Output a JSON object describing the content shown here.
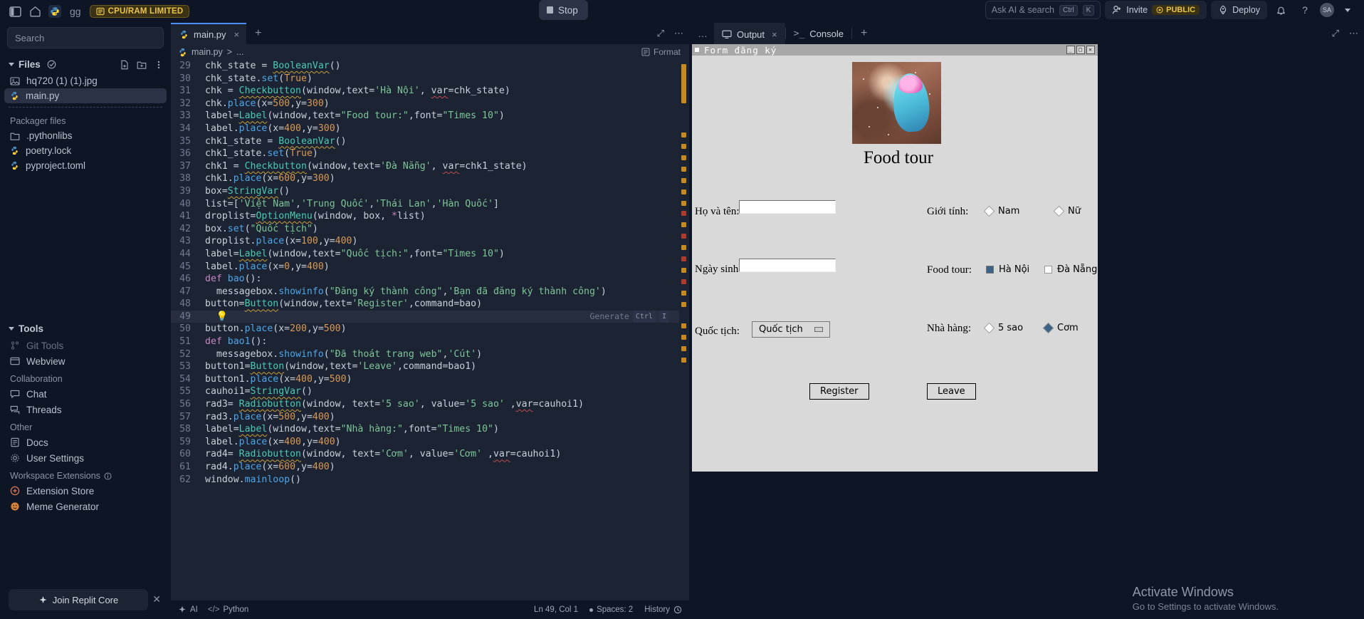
{
  "topbar": {
    "gg_label": "gg",
    "cpu_badge": "CPU/RAM LIMITED",
    "stop_label": "Stop",
    "ask_ai_placeholder": "Ask AI & search",
    "kbd_ctrl": "Ctrl",
    "kbd_k": "K",
    "invite_label": "Invite",
    "public_label": "PUBLIC",
    "deploy_label": "Deploy",
    "avatar_initials": "SA"
  },
  "sidebar": {
    "search_placeholder": "Search",
    "files_title": "Files",
    "files": [
      {
        "name": "hq720 (1) (1).jpg",
        "icon": "image-icon",
        "selected": false
      },
      {
        "name": "main.py",
        "icon": "python-icon",
        "selected": true
      }
    ],
    "packager_title": "Packager files",
    "packager_files": [
      {
        "name": ".pythonlibs",
        "icon": "folder-icon"
      },
      {
        "name": "poetry.lock",
        "icon": "python-icon"
      },
      {
        "name": "pyproject.toml",
        "icon": "python-icon"
      }
    ],
    "tools_title": "Tools",
    "tools": [
      {
        "name": "Git Tools",
        "icon": "git-icon"
      },
      {
        "name": "Webview",
        "icon": "webview-icon"
      }
    ],
    "collab_title": "Collaboration",
    "collab": [
      {
        "name": "Chat",
        "icon": "chat-icon"
      },
      {
        "name": "Threads",
        "icon": "threads-icon"
      }
    ],
    "other_title": "Other",
    "other": [
      {
        "name": "Docs",
        "icon": "docs-icon"
      },
      {
        "name": "User Settings",
        "icon": "gear-icon"
      }
    ],
    "ext_title": "Workspace Extensions",
    "extensions": [
      {
        "name": "Extension Store",
        "icon": "store-icon"
      },
      {
        "name": "Meme Generator",
        "icon": "meme-icon"
      }
    ],
    "core_button": "Join Replit Core"
  },
  "editor": {
    "tab_name": "main.py",
    "tab_plus": "+",
    "breadcrumb_file": "main.py",
    "breadcrumb_sep": ">",
    "breadcrumb_rest": "...",
    "format_label": "Format",
    "ghost_label": "Generate",
    "ghost_kbd1": "Ctrl",
    "ghost_kbd2": "I",
    "lines": [
      {
        "n": 29,
        "tokens": [
          [
            "id",
            "chk_state "
          ],
          [
            "op",
            "= "
          ],
          [
            "cls",
            "BooleanVar"
          ],
          [
            "op",
            "()"
          ]
        ]
      },
      {
        "n": 30,
        "tokens": [
          [
            "id",
            "chk_state."
          ],
          [
            "fn",
            "set"
          ],
          [
            "op",
            "("
          ],
          [
            "bool",
            "True"
          ],
          [
            "op",
            ")"
          ]
        ]
      },
      {
        "n": 31,
        "tokens": [
          [
            "id",
            "chk "
          ],
          [
            "op",
            "= "
          ],
          [
            "cls",
            "Checkbutton"
          ],
          [
            "op",
            "(window,text="
          ],
          [
            "str",
            "'Hà Nội'"
          ],
          [
            "op",
            ", "
          ],
          [
            "var",
            "var"
          ],
          [
            "op",
            "=chk_state)"
          ]
        ]
      },
      {
        "n": 32,
        "tokens": [
          [
            "id",
            "chk."
          ],
          [
            "fn",
            "place"
          ],
          [
            "op",
            "(x="
          ],
          [
            "num",
            "500"
          ],
          [
            "op",
            ",y="
          ],
          [
            "num",
            "300"
          ],
          [
            "op",
            ")"
          ]
        ]
      },
      {
        "n": 33,
        "tokens": [
          [
            "id",
            "label="
          ],
          [
            "cls",
            "Label"
          ],
          [
            "op",
            "(window,text="
          ],
          [
            "str",
            "\"Food tour:\""
          ],
          [
            "op",
            ",font="
          ],
          [
            "str",
            "\"Times 10\""
          ],
          [
            "op",
            ")"
          ]
        ]
      },
      {
        "n": 34,
        "tokens": [
          [
            "id",
            "label."
          ],
          [
            "fn",
            "place"
          ],
          [
            "op",
            "(x="
          ],
          [
            "num",
            "400"
          ],
          [
            "op",
            ",y="
          ],
          [
            "num",
            "300"
          ],
          [
            "op",
            ")"
          ]
        ]
      },
      {
        "n": 35,
        "tokens": [
          [
            "id",
            "chk1_state "
          ],
          [
            "op",
            "= "
          ],
          [
            "cls",
            "BooleanVar"
          ],
          [
            "op",
            "()"
          ]
        ]
      },
      {
        "n": 36,
        "tokens": [
          [
            "id",
            "chk1_state."
          ],
          [
            "fn",
            "set"
          ],
          [
            "op",
            "("
          ],
          [
            "bool",
            "True"
          ],
          [
            "op",
            ")"
          ]
        ]
      },
      {
        "n": 37,
        "tokens": [
          [
            "id",
            "chk1 "
          ],
          [
            "op",
            "= "
          ],
          [
            "cls",
            "Checkbutton"
          ],
          [
            "op",
            "(window,text="
          ],
          [
            "str",
            "'Đà Nẵng'"
          ],
          [
            "op",
            ", "
          ],
          [
            "var",
            "var"
          ],
          [
            "op",
            "=chk1_state)"
          ]
        ]
      },
      {
        "n": 38,
        "tokens": [
          [
            "id",
            "chk1."
          ],
          [
            "fn",
            "place"
          ],
          [
            "op",
            "(x="
          ],
          [
            "num",
            "600"
          ],
          [
            "op",
            ",y="
          ],
          [
            "num",
            "300"
          ],
          [
            "op",
            ")"
          ]
        ]
      },
      {
        "n": 39,
        "tokens": [
          [
            "id",
            "box="
          ],
          [
            "cls",
            "StringVar"
          ],
          [
            "op",
            "()"
          ]
        ]
      },
      {
        "n": 40,
        "tokens": [
          [
            "id",
            "list=["
          ],
          [
            "str",
            "'Việt Nam'"
          ],
          [
            "op",
            ","
          ],
          [
            "str",
            "'Trung Quốc'"
          ],
          [
            "op",
            ","
          ],
          [
            "str",
            "'Thái Lan'"
          ],
          [
            "op",
            ","
          ],
          [
            "str",
            "'Hàn Quốc'"
          ],
          [
            "op",
            "]"
          ]
        ]
      },
      {
        "n": 41,
        "tokens": [
          [
            "id",
            "droplist="
          ],
          [
            "cls",
            "OptionMenu"
          ],
          [
            "op",
            "(window, box, "
          ],
          [
            "kw",
            "*"
          ],
          [
            "id",
            "list"
          ],
          [
            "op",
            ")"
          ]
        ]
      },
      {
        "n": 42,
        "tokens": [
          [
            "id",
            "box."
          ],
          [
            "fn",
            "set"
          ],
          [
            "op",
            "("
          ],
          [
            "str",
            "\"Quốc tịch\""
          ],
          [
            "op",
            ")"
          ]
        ]
      },
      {
        "n": 43,
        "tokens": [
          [
            "id",
            "droplist."
          ],
          [
            "fn",
            "place"
          ],
          [
            "op",
            "(x="
          ],
          [
            "num",
            "100"
          ],
          [
            "op",
            ",y="
          ],
          [
            "num",
            "400"
          ],
          [
            "op",
            ")"
          ]
        ]
      },
      {
        "n": 44,
        "tokens": [
          [
            "id",
            "label="
          ],
          [
            "cls",
            "Label"
          ],
          [
            "op",
            "(window,text="
          ],
          [
            "str",
            "\"Quốc tịch:\""
          ],
          [
            "op",
            ",font="
          ],
          [
            "str",
            "\"Times 10\""
          ],
          [
            "op",
            ")"
          ]
        ]
      },
      {
        "n": 45,
        "tokens": [
          [
            "id",
            "label."
          ],
          [
            "fn",
            "place"
          ],
          [
            "op",
            "(x="
          ],
          [
            "num",
            "0"
          ],
          [
            "op",
            ",y="
          ],
          [
            "num",
            "400"
          ],
          [
            "op",
            ")"
          ]
        ]
      },
      {
        "n": 46,
        "tokens": [
          [
            "kw",
            "def "
          ],
          [
            "fn",
            "bao"
          ],
          [
            "op",
            "():"
          ]
        ]
      },
      {
        "n": 47,
        "tokens": [
          [
            "op",
            "  messagebox."
          ],
          [
            "fn",
            "showinfo"
          ],
          [
            "op",
            "("
          ],
          [
            "str",
            "\"Đăng ký thành công\""
          ],
          [
            "op",
            ","
          ],
          [
            "str",
            "'Bạn đã đăng ký thành công'"
          ],
          [
            "op",
            ")"
          ]
        ]
      },
      {
        "n": 48,
        "tokens": [
          [
            "id",
            "button="
          ],
          [
            "cls",
            "Button"
          ],
          [
            "op",
            "(window,text="
          ],
          [
            "str",
            "'Register'"
          ],
          [
            "op",
            ",command=bao)"
          ]
        ]
      },
      {
        "n": 49,
        "tokens": [
          [
            "bulb",
            "  💡"
          ]
        ],
        "highlight": true
      },
      {
        "n": 50,
        "tokens": [
          [
            "id",
            "button."
          ],
          [
            "fn",
            "place"
          ],
          [
            "op",
            "(x="
          ],
          [
            "num",
            "200"
          ],
          [
            "op",
            ",y="
          ],
          [
            "num",
            "500"
          ],
          [
            "op",
            ")"
          ]
        ]
      },
      {
        "n": 51,
        "tokens": [
          [
            "kw",
            "def "
          ],
          [
            "fn",
            "bao1"
          ],
          [
            "op",
            "():"
          ]
        ]
      },
      {
        "n": 52,
        "tokens": [
          [
            "op",
            "  messagebox."
          ],
          [
            "fn",
            "showinfo"
          ],
          [
            "op",
            "("
          ],
          [
            "str",
            "\"Đã thoát trang web\""
          ],
          [
            "op",
            ","
          ],
          [
            "str",
            "'Cút'"
          ],
          [
            "op",
            ")"
          ]
        ]
      },
      {
        "n": 53,
        "tokens": [
          [
            "id",
            "button1="
          ],
          [
            "cls",
            "Button"
          ],
          [
            "op",
            "(window,text="
          ],
          [
            "str",
            "'Leave'"
          ],
          [
            "op",
            ",command=bao1)"
          ]
        ]
      },
      {
        "n": 54,
        "tokens": [
          [
            "id",
            "button1."
          ],
          [
            "fn",
            "place"
          ],
          [
            "op",
            "(x="
          ],
          [
            "num",
            "400"
          ],
          [
            "op",
            ",y="
          ],
          [
            "num",
            "500"
          ],
          [
            "op",
            ")"
          ]
        ]
      },
      {
        "n": 55,
        "tokens": [
          [
            "id",
            "cauhoi1="
          ],
          [
            "cls",
            "StringVar"
          ],
          [
            "op",
            "()"
          ]
        ]
      },
      {
        "n": 56,
        "tokens": [
          [
            "id",
            "rad3= "
          ],
          [
            "cls",
            "Radiobutton"
          ],
          [
            "op",
            "(window, text="
          ],
          [
            "str",
            "'5 sao'"
          ],
          [
            "op",
            ", value="
          ],
          [
            "str",
            "'5 sao'"
          ],
          [
            "op",
            " ,"
          ],
          [
            "var",
            "var"
          ],
          [
            "op",
            "=cauhoi1)"
          ]
        ]
      },
      {
        "n": 57,
        "tokens": [
          [
            "id",
            "rad3."
          ],
          [
            "fn",
            "place"
          ],
          [
            "op",
            "(x="
          ],
          [
            "num",
            "500"
          ],
          [
            "op",
            ",y="
          ],
          [
            "num",
            "400"
          ],
          [
            "op",
            ")"
          ]
        ]
      },
      {
        "n": 58,
        "tokens": [
          [
            "id",
            "label="
          ],
          [
            "cls",
            "Label"
          ],
          [
            "op",
            "(window,text="
          ],
          [
            "str",
            "\"Nhà hàng:\""
          ],
          [
            "op",
            ",font="
          ],
          [
            "str",
            "\"Times 10\""
          ],
          [
            "op",
            ")"
          ]
        ]
      },
      {
        "n": 59,
        "tokens": [
          [
            "id",
            "label."
          ],
          [
            "fn",
            "place"
          ],
          [
            "op",
            "(x="
          ],
          [
            "num",
            "400"
          ],
          [
            "op",
            ",y="
          ],
          [
            "num",
            "400"
          ],
          [
            "op",
            ")"
          ]
        ]
      },
      {
        "n": 60,
        "tokens": [
          [
            "id",
            "rad4= "
          ],
          [
            "cls",
            "Radiobutton"
          ],
          [
            "op",
            "(window, text="
          ],
          [
            "str",
            "'Cơm'"
          ],
          [
            "op",
            ", value="
          ],
          [
            "str",
            "'Cơm'"
          ],
          [
            "op",
            " ,"
          ],
          [
            "var",
            "var"
          ],
          [
            "op",
            "=cauhoi1)"
          ]
        ]
      },
      {
        "n": 61,
        "tokens": [
          [
            "id",
            "rad4."
          ],
          [
            "fn",
            "place"
          ],
          [
            "op",
            "(x="
          ],
          [
            "num",
            "600"
          ],
          [
            "op",
            ",y="
          ],
          [
            "num",
            "400"
          ],
          [
            "op",
            ")"
          ]
        ]
      },
      {
        "n": 62,
        "tokens": [
          [
            "id",
            "window."
          ],
          [
            "fn",
            "mainloop"
          ],
          [
            "op",
            "()"
          ]
        ]
      }
    ]
  },
  "statusbar": {
    "ai_label": "AI",
    "lang_label": "Python",
    "cursor": "Ln 49, Col 1",
    "spaces": "Spaces: 2",
    "history": "History"
  },
  "output": {
    "dots": "…",
    "tab_output": "Output",
    "tab_console": "Console",
    "tab_plus": "+"
  },
  "tkinter": {
    "window_title": "Form đăng ký",
    "min_label": "_",
    "max_label": "□",
    "close_label": "✕",
    "heading": "Food tour",
    "labels": {
      "name": "Họ và tên:",
      "dob": "Ngày sinh:",
      "nationality": "Quốc tịch:",
      "gender": "Giới tính:",
      "foodtour": "Food tour:",
      "restaurant": "Nhà hàng:"
    },
    "inputs": {
      "name_value": "",
      "dob_value": ""
    },
    "option_menu": {
      "value": "Quốc tịch"
    },
    "gender_options": [
      {
        "label": "Nam",
        "selected": false
      },
      {
        "label": "Nữ",
        "selected": false
      }
    ],
    "foodtour_options": [
      {
        "label": "Hà Nội",
        "checked": true
      },
      {
        "label": "Đà Nẵng",
        "checked": false
      }
    ],
    "restaurant_options": [
      {
        "label": "5 sao",
        "selected": false
      },
      {
        "label": "Cơm",
        "selected": true
      }
    ],
    "buttons": [
      {
        "label": "Register"
      },
      {
        "label": "Leave"
      }
    ]
  },
  "watermark": {
    "line1": "Activate Windows",
    "line2": "Go to Settings to activate Windows."
  },
  "colors": {
    "accent": "#4c8df6",
    "warning": "#e8c44a",
    "bg": "#0e1525",
    "panel": "#1c2333"
  }
}
